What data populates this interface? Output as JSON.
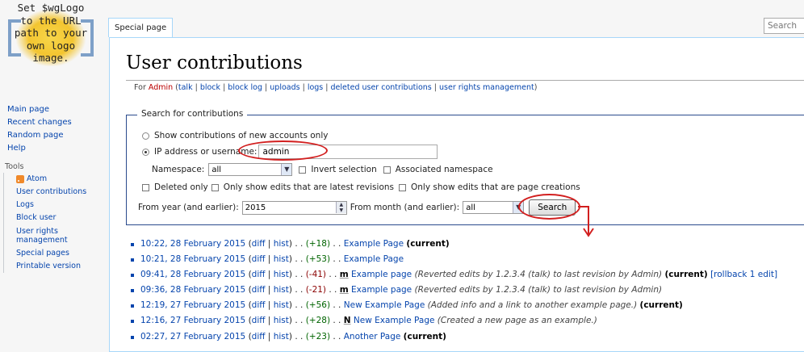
{
  "logo": {
    "text": "Set $wgLogo\nto the URL\npath to your\nown logo\nimage."
  },
  "navigation": [
    {
      "label": "Main page"
    },
    {
      "label": "Recent changes"
    },
    {
      "label": "Random page"
    },
    {
      "label": "Help"
    }
  ],
  "tools": {
    "heading": "Tools",
    "items": [
      {
        "label": "Atom"
      },
      {
        "label": "User contributions"
      },
      {
        "label": "Logs"
      },
      {
        "label": "Block user"
      },
      {
        "label": "User rights management"
      },
      {
        "label": "Special pages"
      },
      {
        "label": "Printable version"
      }
    ]
  },
  "tab": {
    "label": "Special page"
  },
  "search": {
    "placeholder": "Search"
  },
  "page": {
    "title": "User contributions",
    "subtitle": {
      "prefix": "For ",
      "user": "Admin",
      "open": " (",
      "links": [
        "talk",
        "block",
        "block log",
        "uploads",
        "logs",
        "deleted user contributions",
        "user rights management"
      ],
      "close": ")"
    }
  },
  "form": {
    "legend": "Search for contributions",
    "radio_new_accounts": "Show contributions of new accounts only",
    "radio_ip": "IP address or username:",
    "username_value": "admin",
    "namespace_label": "Namespace:",
    "namespace_value": "all",
    "invert_label": "Invert selection",
    "associated_label": "Associated namespace",
    "deleted_only": "Deleted only",
    "latest_only": "Only show edits that are latest revisions",
    "creations_only": "Only show edits that are page creations",
    "year_label": "From year (and earlier):",
    "year_value": "2015",
    "month_label": "From month (and earlier):",
    "month_value": "all",
    "search_button": "Search"
  },
  "results": [
    {
      "ts": "10:22, 28 February 2015",
      "diff": "diff",
      "hist": "hist",
      "size": "(+18)",
      "sign": "pos",
      "flag": "",
      "page": "Example Page",
      "comment": "",
      "current": "(current)",
      "extra": ""
    },
    {
      "ts": "10:21, 28 February 2015",
      "diff": "diff",
      "hist": "hist",
      "size": "(+53)",
      "sign": "pos",
      "flag": "",
      "page": "Example Page",
      "comment": "",
      "current": "",
      "extra": ""
    },
    {
      "ts": "09:41, 28 February 2015",
      "diff": "diff",
      "hist": "hist",
      "size": "(-41)",
      "sign": "neg",
      "flag": "m",
      "page": "Example page",
      "comment": "(Reverted edits by 1.2.3.4 (talk) to last revision by Admin)",
      "current": "(current)",
      "extra": "[rollback 1 edit]"
    },
    {
      "ts": "09:36, 28 February 2015",
      "diff": "diff",
      "hist": "hist",
      "size": "(-21)",
      "sign": "neg",
      "flag": "m",
      "page": "Example page",
      "comment": "(Reverted edits by 1.2.3.4 (talk) to last revision by Admin)",
      "current": "",
      "extra": ""
    },
    {
      "ts": "12:19, 27 February 2015",
      "diff": "diff",
      "hist": "hist",
      "size": "(+56)",
      "sign": "pos",
      "flag": "",
      "page": "New Example Page",
      "comment": "(Added info and a link to another example page.)",
      "current": "(current)",
      "extra": ""
    },
    {
      "ts": "12:16, 27 February 2015",
      "diff": "diff",
      "hist": "hist",
      "size": "(+28)",
      "sign": "pos",
      "flag": "N",
      "page": "New Example Page",
      "comment": "(Created a new page as an example.)",
      "current": "",
      "extra": ""
    },
    {
      "ts": "02:27, 27 February 2015",
      "diff": "diff",
      "hist": "hist",
      "size": "(+23)",
      "sign": "pos",
      "flag": "",
      "page": "Another Page",
      "comment": "",
      "current": "(current)",
      "extra": ""
    }
  ],
  "annotation": {
    "color": "#d21f1f"
  }
}
